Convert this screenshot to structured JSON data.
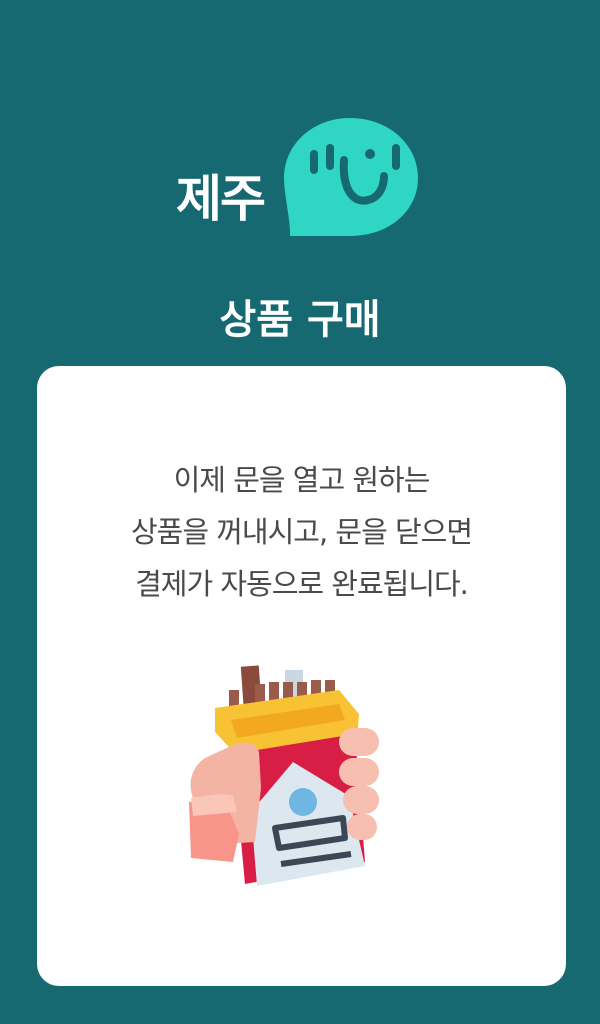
{
  "logo": {
    "text": "제주",
    "icon": "speech-bubble-logo-icon",
    "color": "#2fd6c3"
  },
  "page": {
    "title": "상품 구매"
  },
  "card": {
    "instruction_lines": [
      "이제 문을 열고 원하는",
      "상품을 꺼내시고, 문을 닫으면",
      "결제가 자동으로 완료됩니다."
    ],
    "illustration": "hand-holding-cigarette-pack-icon"
  },
  "colors": {
    "background": "#176971",
    "card": "#ffffff",
    "text": "#4a4a4a"
  }
}
